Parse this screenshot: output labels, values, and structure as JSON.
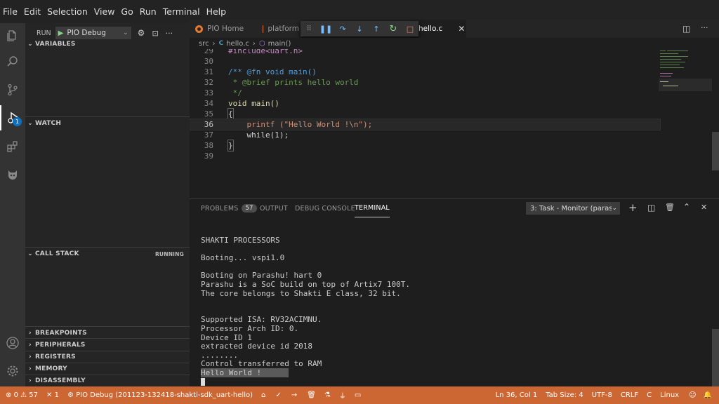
{
  "menu": [
    "File",
    "Edit",
    "Selection",
    "View",
    "Go",
    "Run",
    "Terminal",
    "Help"
  ],
  "sidebar": {
    "run_label": "RUN",
    "config": "PIO Debug",
    "sections": {
      "variables": "VARIABLES",
      "watch": "WATCH",
      "call_stack": "CALL STACK",
      "call_stack_status": "RUNNING",
      "breakpoints": "BREAKPOINTS",
      "peripherals": "PERIPHERALS",
      "registers": "REGISTERS",
      "memory": "MEMORY",
      "disassembly": "DISASSEMBLY"
    }
  },
  "activity": {
    "debug_badge": "1"
  },
  "tabs": [
    {
      "label": "PIO Home"
    },
    {
      "label": "platform"
    },
    {
      "label": "hello.c"
    }
  ],
  "breadcrumb": {
    "folder": "src",
    "file": "hello.c",
    "symbol": "main()"
  },
  "code": [
    {
      "n": "29",
      "t": "#include<uart.h>"
    },
    {
      "n": "30",
      "t": ""
    },
    {
      "n": "31",
      "t": "/** @fn void main()"
    },
    {
      "n": "32",
      "t": " * @brief prints hello world"
    },
    {
      "n": "33",
      "t": " */"
    },
    {
      "n": "34",
      "t": "void main()"
    },
    {
      "n": "35",
      "t": "{"
    },
    {
      "n": "36",
      "t": "    printf (\"Hello World !\\n\");"
    },
    {
      "n": "37",
      "t": "    while(1);"
    },
    {
      "n": "38",
      "t": "}"
    },
    {
      "n": "39",
      "t": ""
    }
  ],
  "panel": {
    "problems": "PROBLEMS",
    "problems_count": "57",
    "output": "OUTPUT",
    "debug_console": "DEBUG CONSOLE",
    "terminal": "TERMINAL",
    "terminal_select": "3: Task - Monitor (paras"
  },
  "terminal": [
    "SHAKTI PROCESSORS",
    "",
    "Booting... vspi1.0",
    "",
    "Booting on Parashu! hart 0",
    "Parashu is a SoC build on top of Artix7 100T.",
    "The core belongs to Shakti E class, 32 bit.",
    "",
    "",
    "Supported ISA: RV32ACIMNU.",
    "Processor Arch ID: 0.",
    "Device ID 1",
    "extracted device id 2018",
    "........",
    "Control transferred to RAM",
    "Hello World !"
  ],
  "status": {
    "errors": "0",
    "warnings": "57",
    "debug_count": "1",
    "debug_session": "PIO Debug (201123-132418-shakti-sdk_uart-hello)",
    "position": "Ln 36, Col 1",
    "tab_size": "Tab Size: 4",
    "encoding": "UTF-8",
    "eol": "CRLF",
    "language": "C",
    "os": "Linux"
  },
  "colors": {
    "status_bg": "#cc6633",
    "accent": "#0e70c0",
    "keyword": "#569cd6",
    "comment": "#6a9955",
    "string": "#ce9178",
    "function": "#dcdcaa",
    "number": "#b5cea8",
    "control": "#c586c0"
  }
}
